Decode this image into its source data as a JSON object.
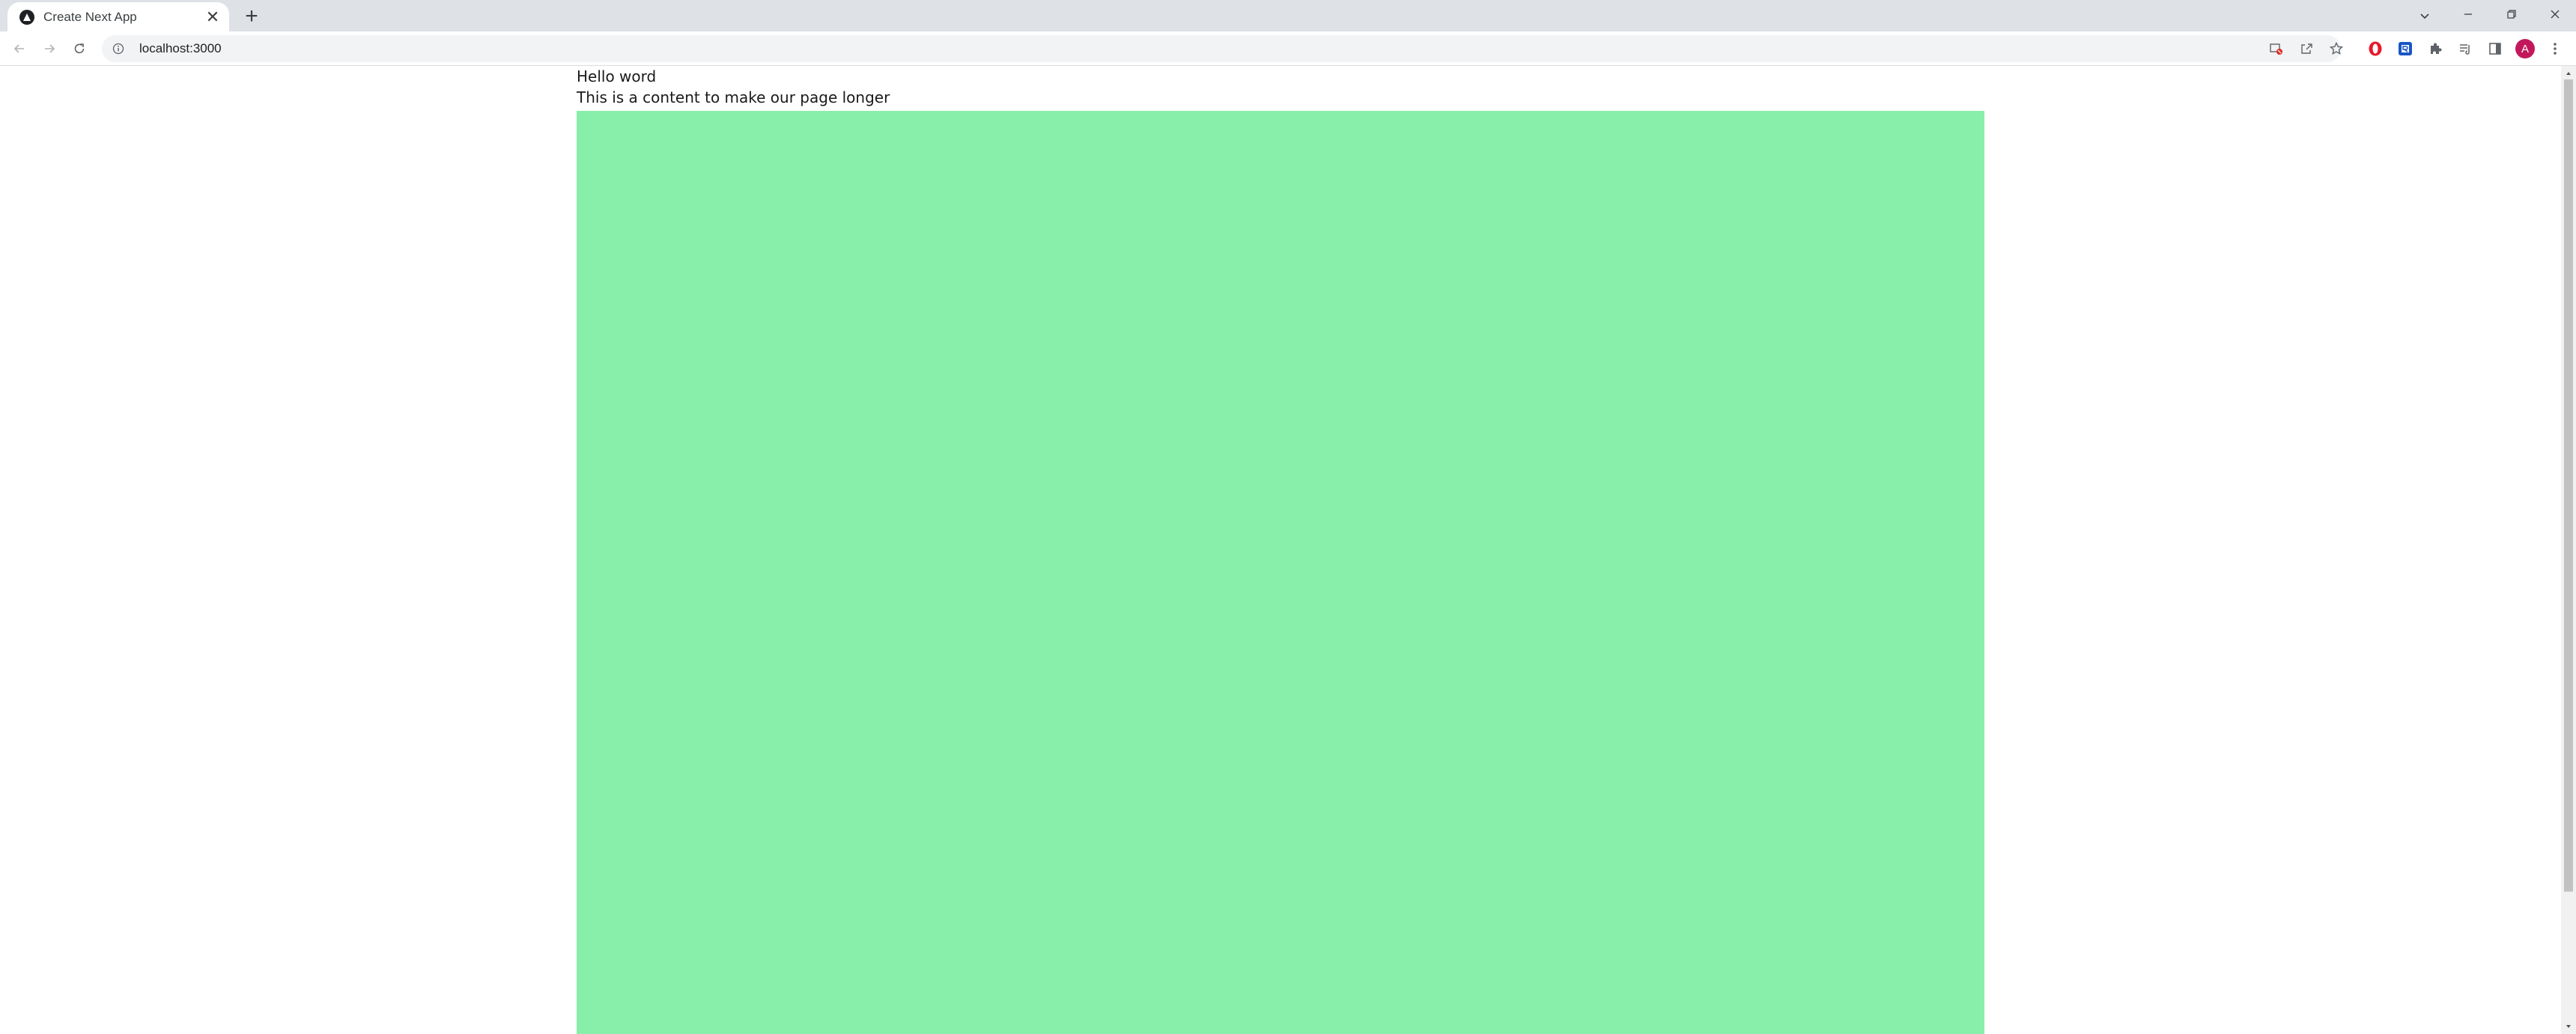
{
  "browser": {
    "tab": {
      "title": "Create Next App",
      "close_glyph": "✕",
      "favicon": "nextjs-logo-icon"
    },
    "new_tab_glyph": "+",
    "address_bar": {
      "url": "localhost:3000"
    },
    "profile_initial": "A"
  },
  "page": {
    "heading_text": "Hello word",
    "body_text": "This is a content to make our page longer",
    "box_color": "#88efab"
  },
  "colors": {
    "tabstrip": "#dee1e6",
    "scroll_thumb": "#c1c1c1",
    "avatar": "#c2185b",
    "opera_red": "#e8192c",
    "ext_blue": "#1a56c4"
  }
}
